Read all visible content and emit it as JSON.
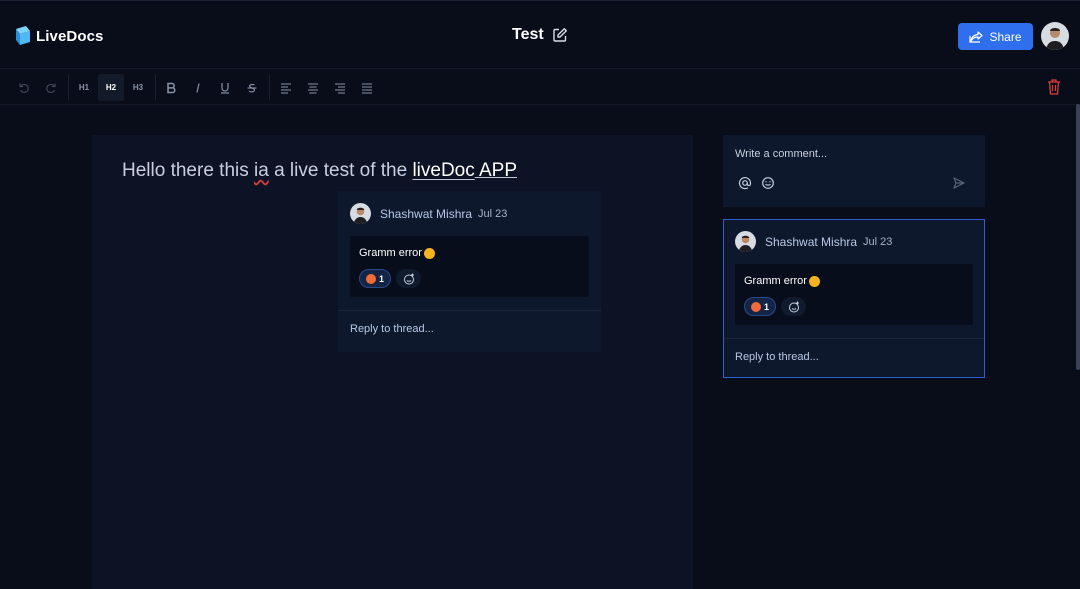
{
  "app": {
    "name": "LiveDocs"
  },
  "document": {
    "title": "Test"
  },
  "header": {
    "share_label": "Share"
  },
  "toolbar": {
    "h1": "H1",
    "h2": "H2",
    "h3": "H3"
  },
  "editor": {
    "text_pre": "Hello there this ",
    "text_typo": "ia",
    "text_mid": " a live test of the ",
    "text_highlight": "liveDoc",
    "text_post": " APP"
  },
  "thread": {
    "author": "Shashwat Mishra",
    "date": "Jul 23",
    "comment": "Gramm error",
    "reaction_count": "1",
    "reply_label": "Reply to thread..."
  },
  "composer": {
    "placeholder": "Write a comment..."
  },
  "colors": {
    "background": "#080d19",
    "panel": "#0e182c",
    "accent": "#2f6fed",
    "danger": "#e03c3c",
    "selected_border": "#2f5fd0"
  }
}
